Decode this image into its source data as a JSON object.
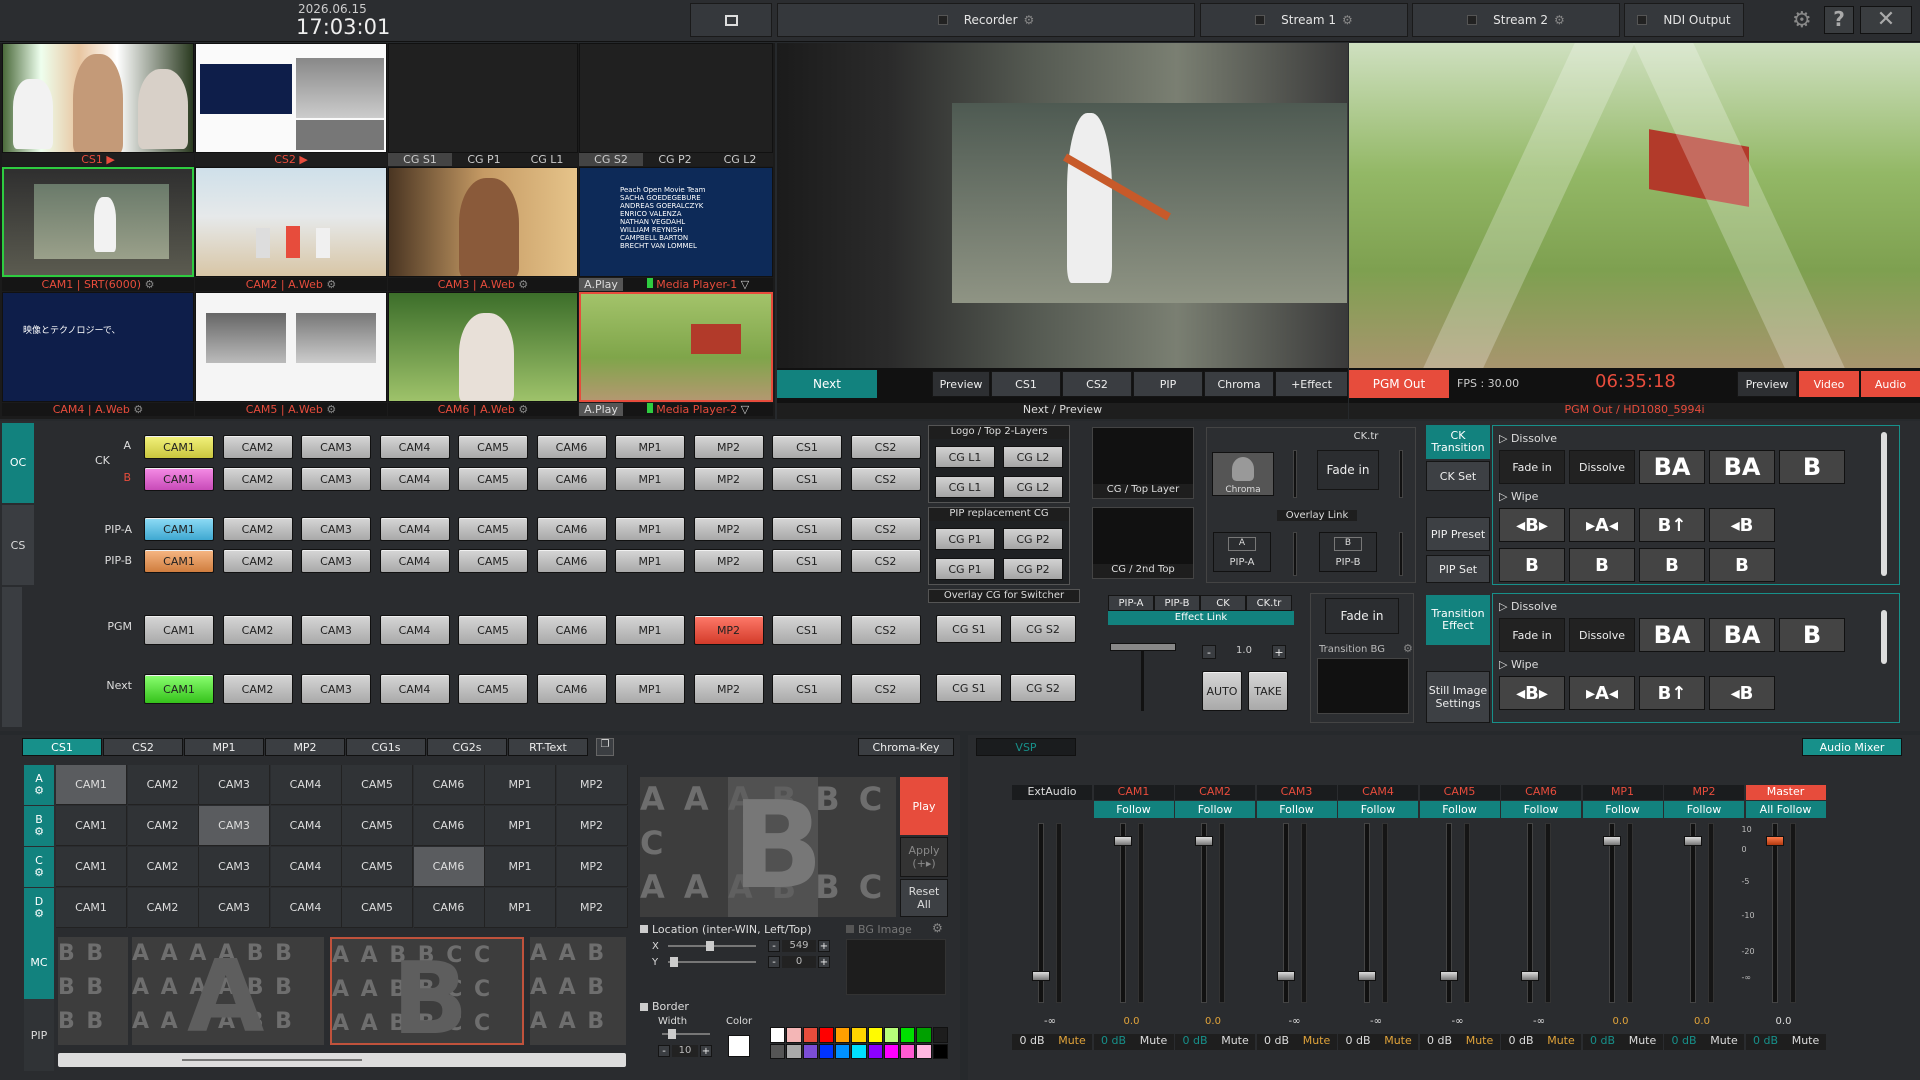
{
  "topbar": {
    "date": "2026.06.15",
    "time": "17:03:01",
    "recorder": "Recorder",
    "stream1": "Stream 1",
    "stream2": "Stream 2",
    "ndi": "NDI Output"
  },
  "sources": {
    "row1_labels": [
      "CS1 ▶",
      "CS2 ▶"
    ],
    "cg_tabs": [
      "CG S1",
      "CG P1",
      "CG L1",
      "CG S2",
      "CG P2",
      "CG L2"
    ],
    "row2_labels": [
      "CAM1 | SRT(6000)",
      "CAM2 | A.Web",
      "CAM3 | A.Web",
      "A.Play",
      "Media Player-1"
    ],
    "row3_labels": [
      "CAM4 | A.Web",
      "CAM5 | A.Web",
      "CAM6 | A.Web",
      "A.Play",
      "Media Player-2"
    ],
    "mp1_credits": [
      "Peach Open Movie Team",
      "SACHA GOEDEGEBURE",
      "ANDREAS GOERALCZYK",
      "ENRICO VALENZA",
      "NATHAN VEGDAHL",
      "WILLIAM REYNISH",
      "CAMPBELL BARTON",
      "BRECHT VAN LOMMEL"
    ]
  },
  "preview": {
    "next_btn": "Next",
    "tabs": [
      "Preview",
      "CS1",
      "CS2",
      "PIP",
      "Chroma",
      "+Effect"
    ],
    "caption": "Next / Preview"
  },
  "pgm": {
    "out_btn": "PGM Out",
    "fps": "FPS : 30.00",
    "timer": "06:35:18",
    "tabs": [
      "Preview",
      "Video",
      "Audio"
    ],
    "caption": "PGM Out / HD1080_5994i"
  },
  "switcher": {
    "sources": [
      "CAM1",
      "CAM2",
      "CAM3",
      "CAM4",
      "CAM5",
      "CAM6",
      "MP1",
      "MP2",
      "CS1",
      "CS2"
    ],
    "oc": "OC",
    "cs": "CS",
    "ck": "CK",
    "a": "A",
    "b": "B",
    "pipa": "PIP-A",
    "pipb": "PIP-B",
    "pgm": "PGM",
    "next": "Next",
    "logo_title": "Logo / Top 2-Layers",
    "cgl1": "CG L1",
    "cgl2": "CG L2",
    "pip_title": "PIP replacement CG",
    "cgp1": "CG P1",
    "cgp2": "CG P2",
    "overlay_title": "Overlay CG for Switcher",
    "cgs1": "CG S1",
    "cgs2": "CG S2",
    "cg_top": "CG / Top Layer",
    "cg_2nd": "CG / 2nd Top",
    "cktr": "CK.tr",
    "fadein": "Fade in",
    "chroma": "Chroma",
    "overlay_link": "Overlay Link",
    "pipa_lbl": "PIP-A",
    "pipb_lbl": "PIP-B",
    "effect_tabs": [
      "PIP-A",
      "PIP-B",
      "CK",
      "CK.tr"
    ],
    "effect_link": "Effect Link",
    "transition_bg": "Transition BG",
    "rate": "1.0",
    "minus": "-",
    "plus": "+",
    "auto": "AUTO",
    "take": "TAKE"
  },
  "transitions": {
    "ck_transition": "CK Transition",
    "ck_set": "CK Set",
    "pip_preset": "PIP Preset",
    "pip_set": "PIP Set",
    "transition_effect": "Transition Effect",
    "still_image": "Still Image Settings",
    "dissolve": "▷ Dissolve",
    "wipe": "▷ Wipe",
    "fadein": "Fade in",
    "dissolve_btn": "Dissolve"
  },
  "composite": {
    "tabs": [
      "CS1",
      "CS2",
      "MP1",
      "MP2",
      "CG1s",
      "CG2s",
      "RT-Text"
    ],
    "chroma_key": "Chroma-Key",
    "rows": [
      "A",
      "B",
      "C",
      "D"
    ],
    "mc": "MC",
    "pip": "PIP",
    "cells": [
      "CAM1",
      "CAM2",
      "CAM3",
      "CAM4",
      "CAM5",
      "CAM6",
      "MP1",
      "MP2"
    ],
    "play": "Play",
    "apply": "Apply (+▸)",
    "reset": "Reset All",
    "location": "Location (inter-WIN, Left/Top)",
    "x": "X",
    "y": "Y",
    "xval": "549",
    "yval": "0",
    "bg_image": "BG Image",
    "border": "Border",
    "width": "Width",
    "color": "Color",
    "wval": "10"
  },
  "audio": {
    "vsp": "VSP",
    "mixer": "Audio Mixer",
    "channels": [
      {
        "name": "ExtAudio",
        "follow": "",
        "db": "0 dB",
        "mute": "Mute",
        "level": "-∞",
        "fader": 0.15
      },
      {
        "name": "CAM1",
        "follow": "Follow",
        "db": "0 dB",
        "mute": "Mute",
        "level": "0.0",
        "fader": 0.9
      },
      {
        "name": "CAM2",
        "follow": "Follow",
        "db": "0 dB",
        "mute": "Mute",
        "level": "0.0",
        "fader": 0.9
      },
      {
        "name": "CAM3",
        "follow": "Follow",
        "db": "0 dB",
        "mute": "Mute",
        "level": "-∞",
        "fader": 0.15
      },
      {
        "name": "CAM4",
        "follow": "Follow",
        "db": "0 dB",
        "mute": "Mute",
        "level": "-∞",
        "fader": 0.15
      },
      {
        "name": "CAM5",
        "follow": "Follow",
        "db": "0 dB",
        "mute": "Mute",
        "level": "-∞",
        "fader": 0.15
      },
      {
        "name": "CAM6",
        "follow": "Follow",
        "db": "0 dB",
        "mute": "Mute",
        "level": "-∞",
        "fader": 0.15
      },
      {
        "name": "MP1",
        "follow": "Follow",
        "db": "0 dB",
        "mute": "Mute",
        "level": "0.0",
        "fader": 0.9
      },
      {
        "name": "MP2",
        "follow": "Follow",
        "db": "0 dB",
        "mute": "Mute",
        "level": "0.0",
        "fader": 0.9
      },
      {
        "name": "Master",
        "follow": "All Follow",
        "db": "0 dB",
        "mute": "Mute",
        "level": "0.0",
        "fader": 0.9
      }
    ],
    "scale": [
      "10",
      "0",
      "-5",
      "-10",
      "-20",
      "-∞"
    ]
  },
  "colors": {
    "teal": "#17908a",
    "red": "#e74c3c",
    "green": "#2ecc40"
  }
}
